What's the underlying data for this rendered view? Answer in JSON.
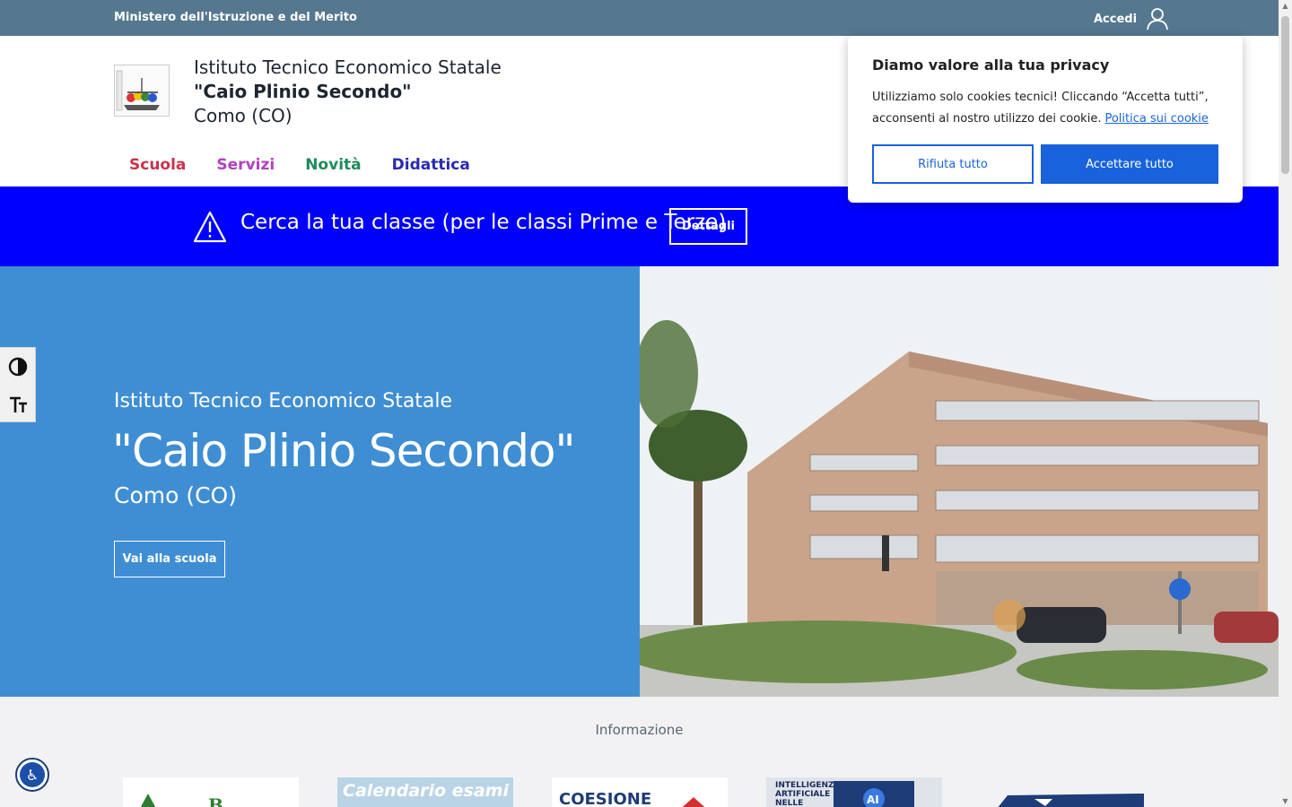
{
  "topbar": {
    "ministry": "Ministero dell'Istruzione e del Merito",
    "login": "Accedi",
    "login_icon": "user-icon"
  },
  "header": {
    "name_line1": "Istituto Tecnico Economico Statale",
    "name_line2": "\"Caio Plinio Secondo\"",
    "name_line3": "Como (CO)"
  },
  "nav": [
    {
      "label": "Scuola",
      "color": "#c8334b"
    },
    {
      "label": "Servizi",
      "color": "#b33fc0"
    },
    {
      "label": "Novità",
      "color": "#1f8a5a"
    },
    {
      "label": "Didattica",
      "color": "#2a2ab0"
    }
  ],
  "alert": {
    "message": "Cerca la tua classe (per le classi Prime e Terze)",
    "button": "Dettagli",
    "icon": "warning-icon"
  },
  "hero": {
    "subtitle": "Istituto Tecnico Economico Statale",
    "title": "\"Caio Plinio Secondo\"",
    "city": "Como (CO)",
    "button": "Vai alla scuola"
  },
  "info": {
    "title": "Informazione",
    "cards": [
      "Calendario esami",
      "COESIONE",
      "INTELLIGENZA ARTIFICIALE NELLE SCUOLE"
    ]
  },
  "cookie": {
    "title": "Diamo valore alla tua privacy",
    "body": "Utilizziamo solo cookies tecnici! Cliccando “Accetta tutti”, acconsenti al nostro utilizzo dei cookie.",
    "link": "Politica sui cookie",
    "reject": "Rifiuta tutto",
    "accept": "Accettare tutto"
  },
  "colors": {
    "topbar": "#56788f",
    "alert": "#0000ff",
    "hero": "#3f8ed3",
    "cookie_accent": "#1863dc"
  }
}
